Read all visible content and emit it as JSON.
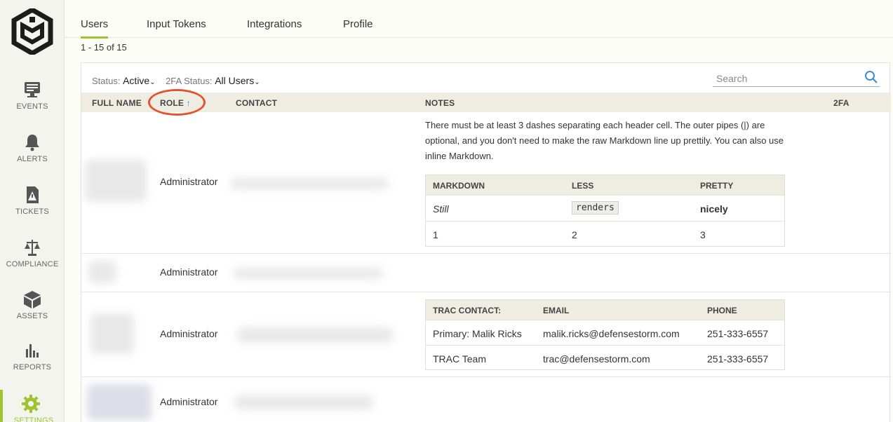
{
  "sidebar": {
    "items": [
      {
        "label": "EVENTS",
        "icon": "monitor-icon"
      },
      {
        "label": "ALERTS",
        "icon": "bell-icon"
      },
      {
        "label": "TICKETS",
        "icon": "ticket-icon"
      },
      {
        "label": "COMPLIANCE",
        "icon": "scales-icon"
      },
      {
        "label": "ASSETS",
        "icon": "cube-icon"
      },
      {
        "label": "REPORTS",
        "icon": "bar-chart-icon"
      },
      {
        "label": "SETTINGS",
        "icon": "gear-icon"
      }
    ],
    "accent": "#9ec431"
  },
  "tabs": {
    "users": "Users",
    "input_tokens": "Input Tokens",
    "integrations": "Integrations",
    "profile": "Profile"
  },
  "count": "1 - 15 of 15",
  "filters": {
    "status_label": "Status:",
    "status_value": "Active",
    "twofa_label": "2FA Status:",
    "twofa_value": "All Users"
  },
  "search": {
    "placeholder": "Search"
  },
  "columns": {
    "full_name": "FULL NAME",
    "role": "ROLE",
    "contact": "CONTACT",
    "notes": "NOTES",
    "twofa": "2FA"
  },
  "rows": [
    {
      "role": "Administrator",
      "note": "There must be at least 3 dashes separating each header cell. The outer pipes (|) are optional, and you don't need to make the raw Markdown line up prettily. You can also use inline Markdown.",
      "note_table": {
        "headers": [
          "MARKDOWN",
          "LESS",
          "PRETTY"
        ],
        "rows": [
          [
            "Still",
            "renders",
            "nicely"
          ],
          [
            "1",
            "2",
            "3"
          ]
        ]
      }
    },
    {
      "role": "Administrator"
    },
    {
      "role": "Administrator",
      "contact_table": {
        "headers": [
          "TRAC CONTACT:",
          "EMAIL",
          "PHONE"
        ],
        "rows": [
          [
            "Primary: Malik Ricks",
            "malik.ricks@defensestorm.com",
            "251-333-6557"
          ],
          [
            "TRAC Team",
            "trac@defensestorm.com",
            "251-333-6557"
          ]
        ]
      }
    },
    {
      "role": "Administrator"
    }
  ],
  "colors": {
    "sort_arrow": "#3a8fd6",
    "highlight_circle": "#e2542f",
    "header_bg": "#efece2"
  }
}
